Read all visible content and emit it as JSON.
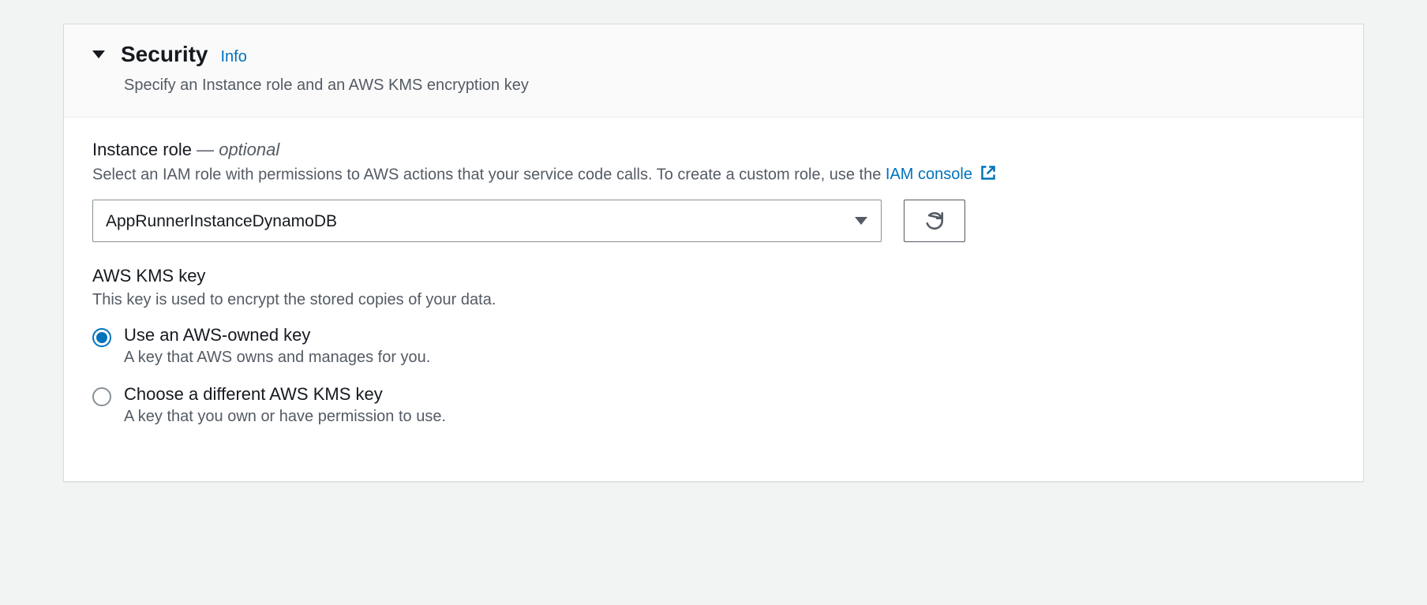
{
  "header": {
    "title": "Security",
    "info_link": "Info",
    "subtitle": "Specify an Instance role and an AWS KMS encryption key"
  },
  "instance_role": {
    "label": "Instance role",
    "optional_suffix": "— optional",
    "help_text_prefix": "Select an IAM role with permissions to AWS actions that your service code calls. To create a custom role, use the ",
    "iam_console_link": "IAM console",
    "selected_value": "AppRunnerInstanceDynamoDB"
  },
  "kms": {
    "label": "AWS KMS key",
    "help_text": "This key is used to encrypt the stored copies of your data.",
    "options": [
      {
        "label": "Use an AWS-owned key",
        "description": "A key that AWS owns and manages for you.",
        "selected": true
      },
      {
        "label": "Choose a different AWS KMS key",
        "description": "A key that you own or have permission to use.",
        "selected": false
      }
    ]
  }
}
